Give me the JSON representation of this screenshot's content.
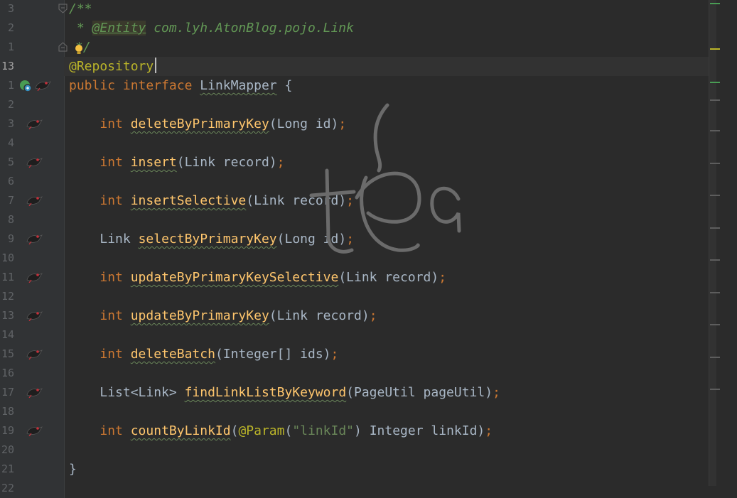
{
  "editor": {
    "gutter_lines": [
      "3",
      "2",
      "1",
      "13",
      "1",
      "2",
      "3",
      "4",
      "5",
      "6",
      "7",
      "8",
      "9",
      "10",
      "11",
      "12",
      "13",
      "14",
      "15",
      "16",
      "17",
      "18",
      "19",
      "20",
      "21",
      "22"
    ],
    "current_line": "13",
    "code": {
      "c_open": "/**",
      "c_star": " * ",
      "c_tag": "@Entity",
      "c_path": " com.lyh.AtonBlog.pojo.Link",
      "c_close": "*/",
      "annotation": "@Repository",
      "decl_public": "public",
      "decl_interface": "interface",
      "decl_name": "LinkMapper",
      "decl_brace": "{",
      "m1_type": "int",
      "m1_name": "deleteByPrimaryKey",
      "m1_args": "(Long id)",
      "m2_type": "int",
      "m2_name": "insert",
      "m2_args": "(Link record)",
      "m3_type": "int",
      "m3_name": "insertSelective",
      "m3_args": "(Link record)",
      "m4_type": "Link",
      "m4_name": "selectByPrimaryKey",
      "m4_args": "(Long id)",
      "m5_type": "int",
      "m5_name": "updateByPrimaryKeySelective",
      "m5_args": "(Link record)",
      "m6_type": "int",
      "m6_name": "updateByPrimaryKey",
      "m6_args": "(Link record)",
      "m7_type": "int",
      "m7_name": "deleteBatch",
      "m7_args": "(Integer[] ids)",
      "m8_type": "List<Link>",
      "m8_name": "findLinkListByKeyword",
      "m8_args": "(PageUtil pageUtil)",
      "m9_type": "int",
      "m9_name": "countByLinkId",
      "m9_args_open": "(",
      "m9_ann": "@Param",
      "m9_str_open": "(",
      "m9_str": "\"linkId\"",
      "m9_rest": ") Integer linkId)",
      "semicolon": ";",
      "close_brace": "}"
    }
  },
  "icons": {
    "mapper_icon": "mybatis-bird-icon",
    "interface_icon": "implemented-interface-icon",
    "bulb_icon": "lightbulb-icon",
    "fold_icon": "fold-icon"
  },
  "colors": {
    "background": "#2b2b2b",
    "keyword": "#cc7832",
    "method": "#ffc66d",
    "annotation": "#bbb529",
    "string": "#6a8759",
    "comment": "#629755",
    "text": "#a9b7c6"
  },
  "watermark": {
    "text": "tea"
  }
}
